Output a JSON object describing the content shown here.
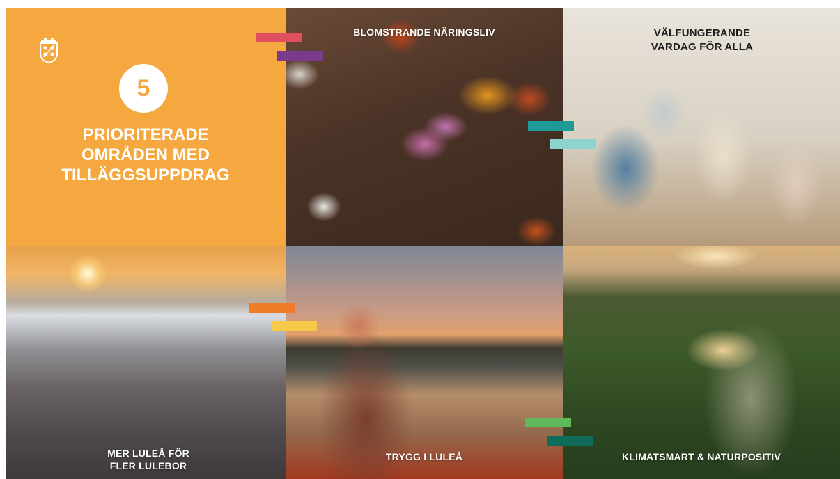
{
  "intro": {
    "number": "5",
    "headline_lines": [
      "PRIORITERADE",
      "OMRÅDEN MED",
      "TILLÄGGSUPPDRAG"
    ],
    "crest_icon": "coat-of-arms-icon"
  },
  "areas": [
    {
      "title_lines": [
        "BLOMSTRANDE NÄRINGSLIV"
      ]
    },
    {
      "title_lines": [
        "VÄLFUNGERANDE",
        "VARDAG FÖR ALLA"
      ]
    },
    {
      "title_lines": [
        "MER LULEÅ FÖR",
        "FLER LULEBOR"
      ]
    },
    {
      "title_lines": [
        "TRYGG I LULEÅ"
      ]
    },
    {
      "title_lines": [
        "KLIMATSMART & NATURPOSITIV"
      ]
    }
  ],
  "colors": {
    "orange_background": "#f5a83f",
    "accent_red": "#e04f5f",
    "accent_purple": "#7a3b8c",
    "accent_teal_dark": "#1e9b96",
    "accent_teal_light": "#8fd3cf",
    "accent_orange": "#f07c2a",
    "accent_yellow": "#f7c94a",
    "accent_green_light": "#5fb85a",
    "accent_green_dark": "#0f6b5a"
  }
}
